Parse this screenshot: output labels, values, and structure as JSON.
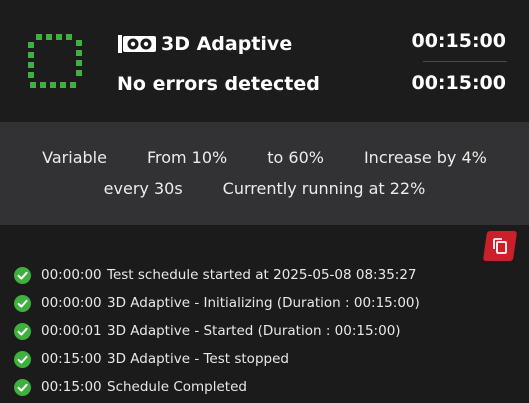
{
  "header": {
    "status_icon": "dotted-square-green-icon",
    "test_icon": "gpu-card-icon",
    "test_name": "3D Adaptive",
    "status_message": "No errors detected",
    "timer_elapsed": "00:15:00",
    "timer_total": "00:15:00",
    "accent_color": "#3db03d"
  },
  "settings": {
    "mode": "Variable",
    "from": "From 10%",
    "to": "to 60%",
    "increase": "Increase by 4%",
    "interval": "every 30s",
    "current": "Currently running at 22%"
  },
  "log": {
    "copy_icon": "copy-icon",
    "copy_color": "#cc1f2c",
    "entry_icon": "check-circle-icon",
    "entries": [
      {
        "time": "00:00:00",
        "message": "Test schedule started at 2025-05-08 08:35:27"
      },
      {
        "time": "00:00:00",
        "message": "3D Adaptive - Initializing (Duration : 00:15:00)"
      },
      {
        "time": "00:00:01",
        "message": "3D Adaptive - Started (Duration : 00:15:00)"
      },
      {
        "time": "00:15:00",
        "message": "3D Adaptive - Test stopped"
      },
      {
        "time": "00:15:00",
        "message": "Schedule Completed"
      }
    ]
  }
}
